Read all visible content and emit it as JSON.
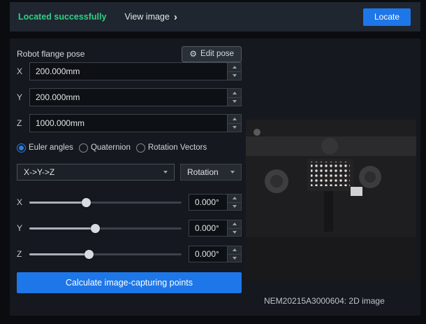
{
  "topbar": {
    "status": "Located successfully",
    "view_image_label": "View image",
    "view_image_chevron": "›",
    "locate_label": "Locate"
  },
  "pose": {
    "title": "Robot flange pose",
    "edit_pose_label": "Edit pose",
    "gear_icon": "⚙",
    "fields": [
      {
        "axis": "X",
        "value": "200.000mm"
      },
      {
        "axis": "Y",
        "value": "200.000mm"
      },
      {
        "axis": "Z",
        "value": "1000.000mm"
      }
    ],
    "rotation_modes": [
      {
        "label": "Euler angles",
        "selected": true
      },
      {
        "label": "Quaternion",
        "selected": false
      },
      {
        "label": "Rotation Vectors",
        "selected": false
      }
    ],
    "euler_order": {
      "value": "X->Y->Z"
    },
    "rotation_combo": {
      "value": "Rotation"
    },
    "angles": [
      {
        "axis": "X",
        "value": "0.000°",
        "handle_style": "left:37%",
        "fill_style": "width:37%"
      },
      {
        "axis": "Y",
        "value": "0.000°",
        "handle_style": "left:43%",
        "fill_style": "width:43%"
      },
      {
        "axis": "Z",
        "value": "0.000°",
        "handle_style": "left:39%",
        "fill_style": "width:39%"
      }
    ],
    "calculate_label": "Calculate image-capturing points"
  },
  "image_panel": {
    "caption": "NEM20215A3000604: 2D image"
  }
}
